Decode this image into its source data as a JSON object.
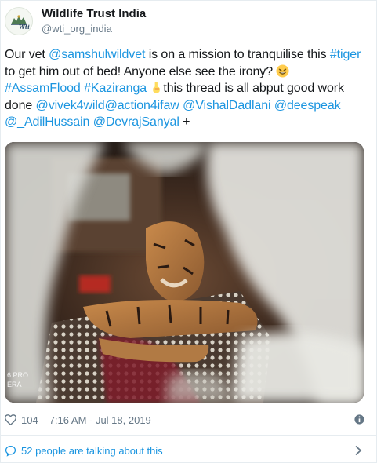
{
  "account": {
    "display_name": "Wildlife Trust India",
    "handle": "@wti_org_india",
    "avatar_icon": "wti-logo-icon",
    "avatar_text": "Wti"
  },
  "tweet": {
    "segments": [
      {
        "text": "Our vet ",
        "link": false
      },
      {
        "text": "@samshulwildvet",
        "link": true
      },
      {
        "text": " is on a mission to tranquilise this ",
        "link": false
      },
      {
        "text": "#tiger",
        "link": true
      },
      {
        "text": " to get him out of bed! Anyone else see the irony? ",
        "link": false
      },
      {
        "emoji": "laughing-face-emoji"
      },
      {
        "text": " ",
        "link": false
      },
      {
        "text": "#AssamFlood",
        "link": true
      },
      {
        "text": " ",
        "link": false
      },
      {
        "text": "#Kaziranga",
        "link": true
      },
      {
        "text": " ",
        "link": false
      },
      {
        "emoji": "pointing-up-emoji"
      },
      {
        "text": "this thread is all abput good work done ",
        "link": false
      },
      {
        "text": "@vivek4wild",
        "link": true
      },
      {
        "text": "@action4ifaw",
        "link": true
      },
      {
        "text": " ",
        "link": false
      },
      {
        "text": "@VishalDadlani",
        "link": true
      },
      {
        "text": " ",
        "link": false
      },
      {
        "text": "@deespeak",
        "link": true
      },
      {
        "text": " ",
        "link": false
      },
      {
        "text": "@_AdilHussain",
        "link": true
      },
      {
        "text": " ",
        "link": false
      },
      {
        "text": "@DevrajSanyal",
        "link": true
      },
      {
        "text": " +",
        "link": false
      }
    ]
  },
  "media": {
    "description_icon": "photo-tiger-on-bed",
    "watermark_line1": "6 PRO",
    "watermark_line2": "ERA"
  },
  "meta": {
    "like_count": "104",
    "timestamp": "7:16 AM - Jul 18, 2019",
    "like_icon": "heart-icon",
    "info_icon": "info-icon"
  },
  "conversation": {
    "label": "52 people are talking about this",
    "icon": "speech-bubble-icon",
    "chevron_icon": "chevron-right-icon"
  },
  "colors": {
    "link": "#1b95e0",
    "text": "#14171a",
    "secondary": "#657786",
    "border": "#e6ecf0"
  }
}
